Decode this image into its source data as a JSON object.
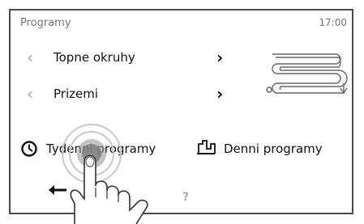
{
  "header": {
    "title": "Programy",
    "time": "17:00"
  },
  "rows": [
    {
      "label": "Topne okruhy"
    },
    {
      "label": "Prizemi"
    }
  ],
  "programs": {
    "weekly_label": "Tydenni programy",
    "daily_label": "Denni programy"
  },
  "footer": {
    "help_label": "?"
  },
  "icons": {
    "row_prev": "chevron-left-icon",
    "row_next": "chevron-right-icon",
    "heating_circuit": "heating-coil-icon",
    "weekly": "clock-icon",
    "daily": "day-profile-icon",
    "back": "back-arrow-icon"
  },
  "colors": {
    "frame": "#4a4a4a",
    "text": "#111111",
    "muted": "#777777",
    "disabled_chevron": "#b8b8b8"
  }
}
